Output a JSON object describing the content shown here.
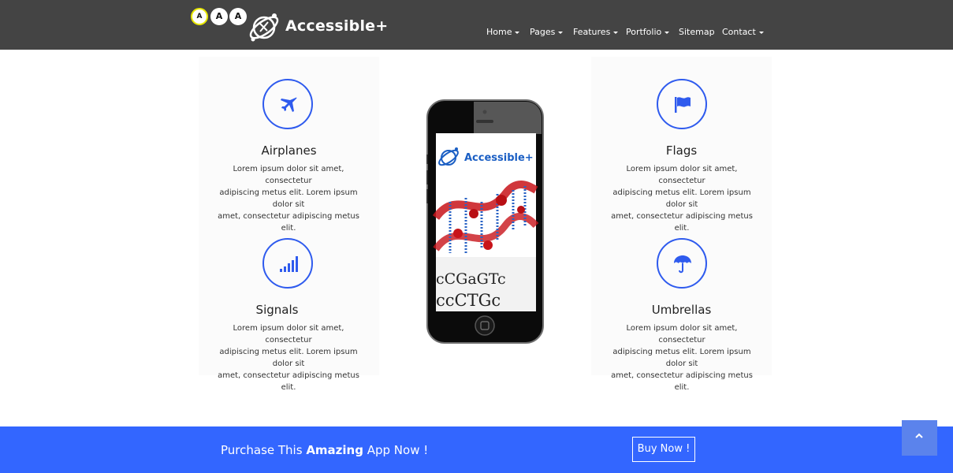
{
  "header": {
    "font_size_buttons": [
      "A",
      "A",
      "A"
    ],
    "brand": "Accessible+",
    "nav": [
      {
        "label": "Home",
        "dropdown": true
      },
      {
        "label": "Pages",
        "dropdown": true
      },
      {
        "label": "Features",
        "dropdown": true
      },
      {
        "label": "Portfolio",
        "dropdown": true
      },
      {
        "label": "Sitemap",
        "dropdown": false
      },
      {
        "label": "Contact",
        "dropdown": true
      }
    ]
  },
  "features": [
    {
      "title": "Airplanes",
      "icon": "airplane-icon",
      "desc_1": "Lorem ipsum dolor sit amet, consectetur",
      "desc_2": "adipiscing metus elit. Lorem ipsum dolor sit",
      "desc_3": "amet, consectetur adipiscing metus elit."
    },
    {
      "title": "Signals",
      "icon": "signal-bars-icon",
      "desc_1": "Lorem ipsum dolor sit amet, consectetur",
      "desc_2": "adipiscing metus elit. Lorem ipsum dolor sit",
      "desc_3": "amet, consectetur adipiscing metus elit."
    },
    {
      "title": "Flags",
      "icon": "flag-icon",
      "desc_1": "Lorem ipsum dolor sit amet, consectetur",
      "desc_2": "adipiscing metus elit. Lorem ipsum dolor sit",
      "desc_3": "amet, consectetur adipiscing metus elit."
    },
    {
      "title": "Umbrellas",
      "icon": "umbrella-icon",
      "desc_1": "Lorem ipsum dolor sit amet, consectetur",
      "desc_2": "adipiscing metus elit. Lorem ipsum dolor sit",
      "desc_3": "amet, consectetur adipiscing metus elit."
    }
  ],
  "phone": {
    "screen_brand": "Accessible+",
    "dna_letters_1": "cCGaGTc",
    "dna_letters_2": "ccCTGc"
  },
  "banner": {
    "text_before": "Purchase This ",
    "text_bold": "Amazing",
    "text_after": " App Now !",
    "button": "Buy Now !"
  },
  "colors": {
    "header_bg": "#444444",
    "accent": "#3366ff",
    "icon_blue": "#2f5bee"
  }
}
